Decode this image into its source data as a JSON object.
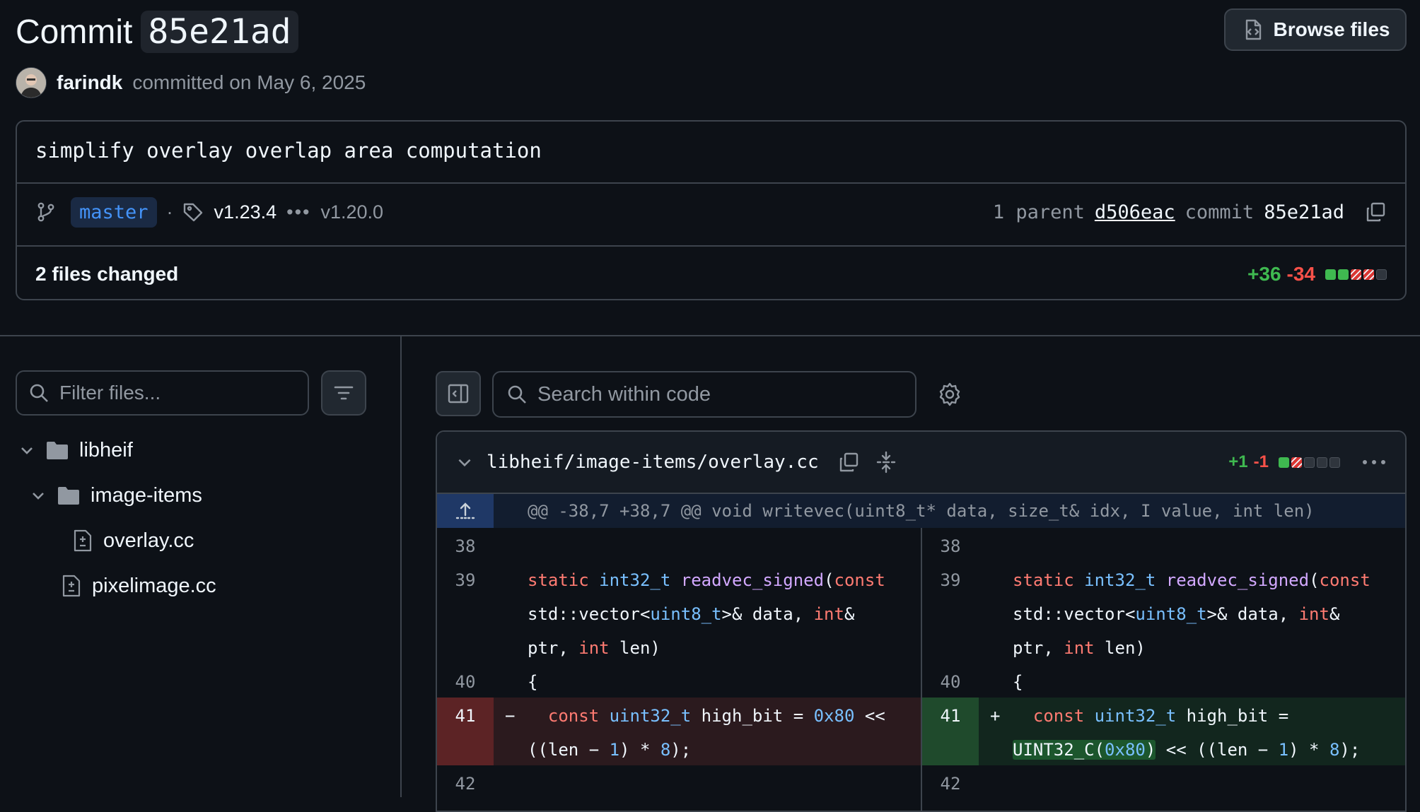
{
  "header": {
    "title_word": "Commit",
    "sha": "85e21ad",
    "browse_files_label": "Browse files",
    "author": "farindk",
    "commit_date_text": "committed on May 6, 2025"
  },
  "commit": {
    "message": "simplify overlay overlap area computation",
    "branch": "master",
    "tag_first": "v1.23.4",
    "tag_ellipsis": "•••",
    "tag_last": "v1.20.0",
    "parent_prefix": "1 parent",
    "parent_sha": "d506eac",
    "commit_label": "commit",
    "commit_sha": "85e21ad",
    "files_changed": "2 files changed",
    "additions": "+36",
    "deletions": "-34"
  },
  "sidebar": {
    "filter_placeholder": "Filter files...",
    "tree": [
      {
        "label": "libheif",
        "kind": "folder"
      },
      {
        "label": "image-items",
        "kind": "folder"
      },
      {
        "label": "overlay.cc",
        "kind": "file"
      },
      {
        "label": "pixelimage.cc",
        "kind": "file"
      }
    ]
  },
  "code_toolbar": {
    "search_placeholder": "Search within code"
  },
  "diff": {
    "file_path": "libheif/image-items/overlay.cc",
    "additions": "+1",
    "deletions": "-1",
    "hunk_header": "@@ -38,7 +38,7 @@ void writevec(uint8_t* data, size_t& idx, I value, int len)",
    "line_numbers": {
      "l38": "38",
      "l39": "39",
      "l40": "40",
      "l41": "41",
      "l42": "42"
    },
    "deleted_marker": "−",
    "added_marker": "+"
  },
  "colors": {
    "background": "#0d1117",
    "addition": "#3fb950",
    "deletion": "#f85149",
    "link_blue": "#4493f8"
  },
  "icons": [
    "file-diff-icon",
    "git-branch-icon",
    "tag-icon",
    "copy-icon",
    "search-icon",
    "filter-icon",
    "chevron-down-icon",
    "folder-icon",
    "file-diff-small-icon",
    "sidebar-toggle-icon",
    "gear-icon",
    "unfold-icon",
    "kebab-icon",
    "expand-up-icon"
  ]
}
